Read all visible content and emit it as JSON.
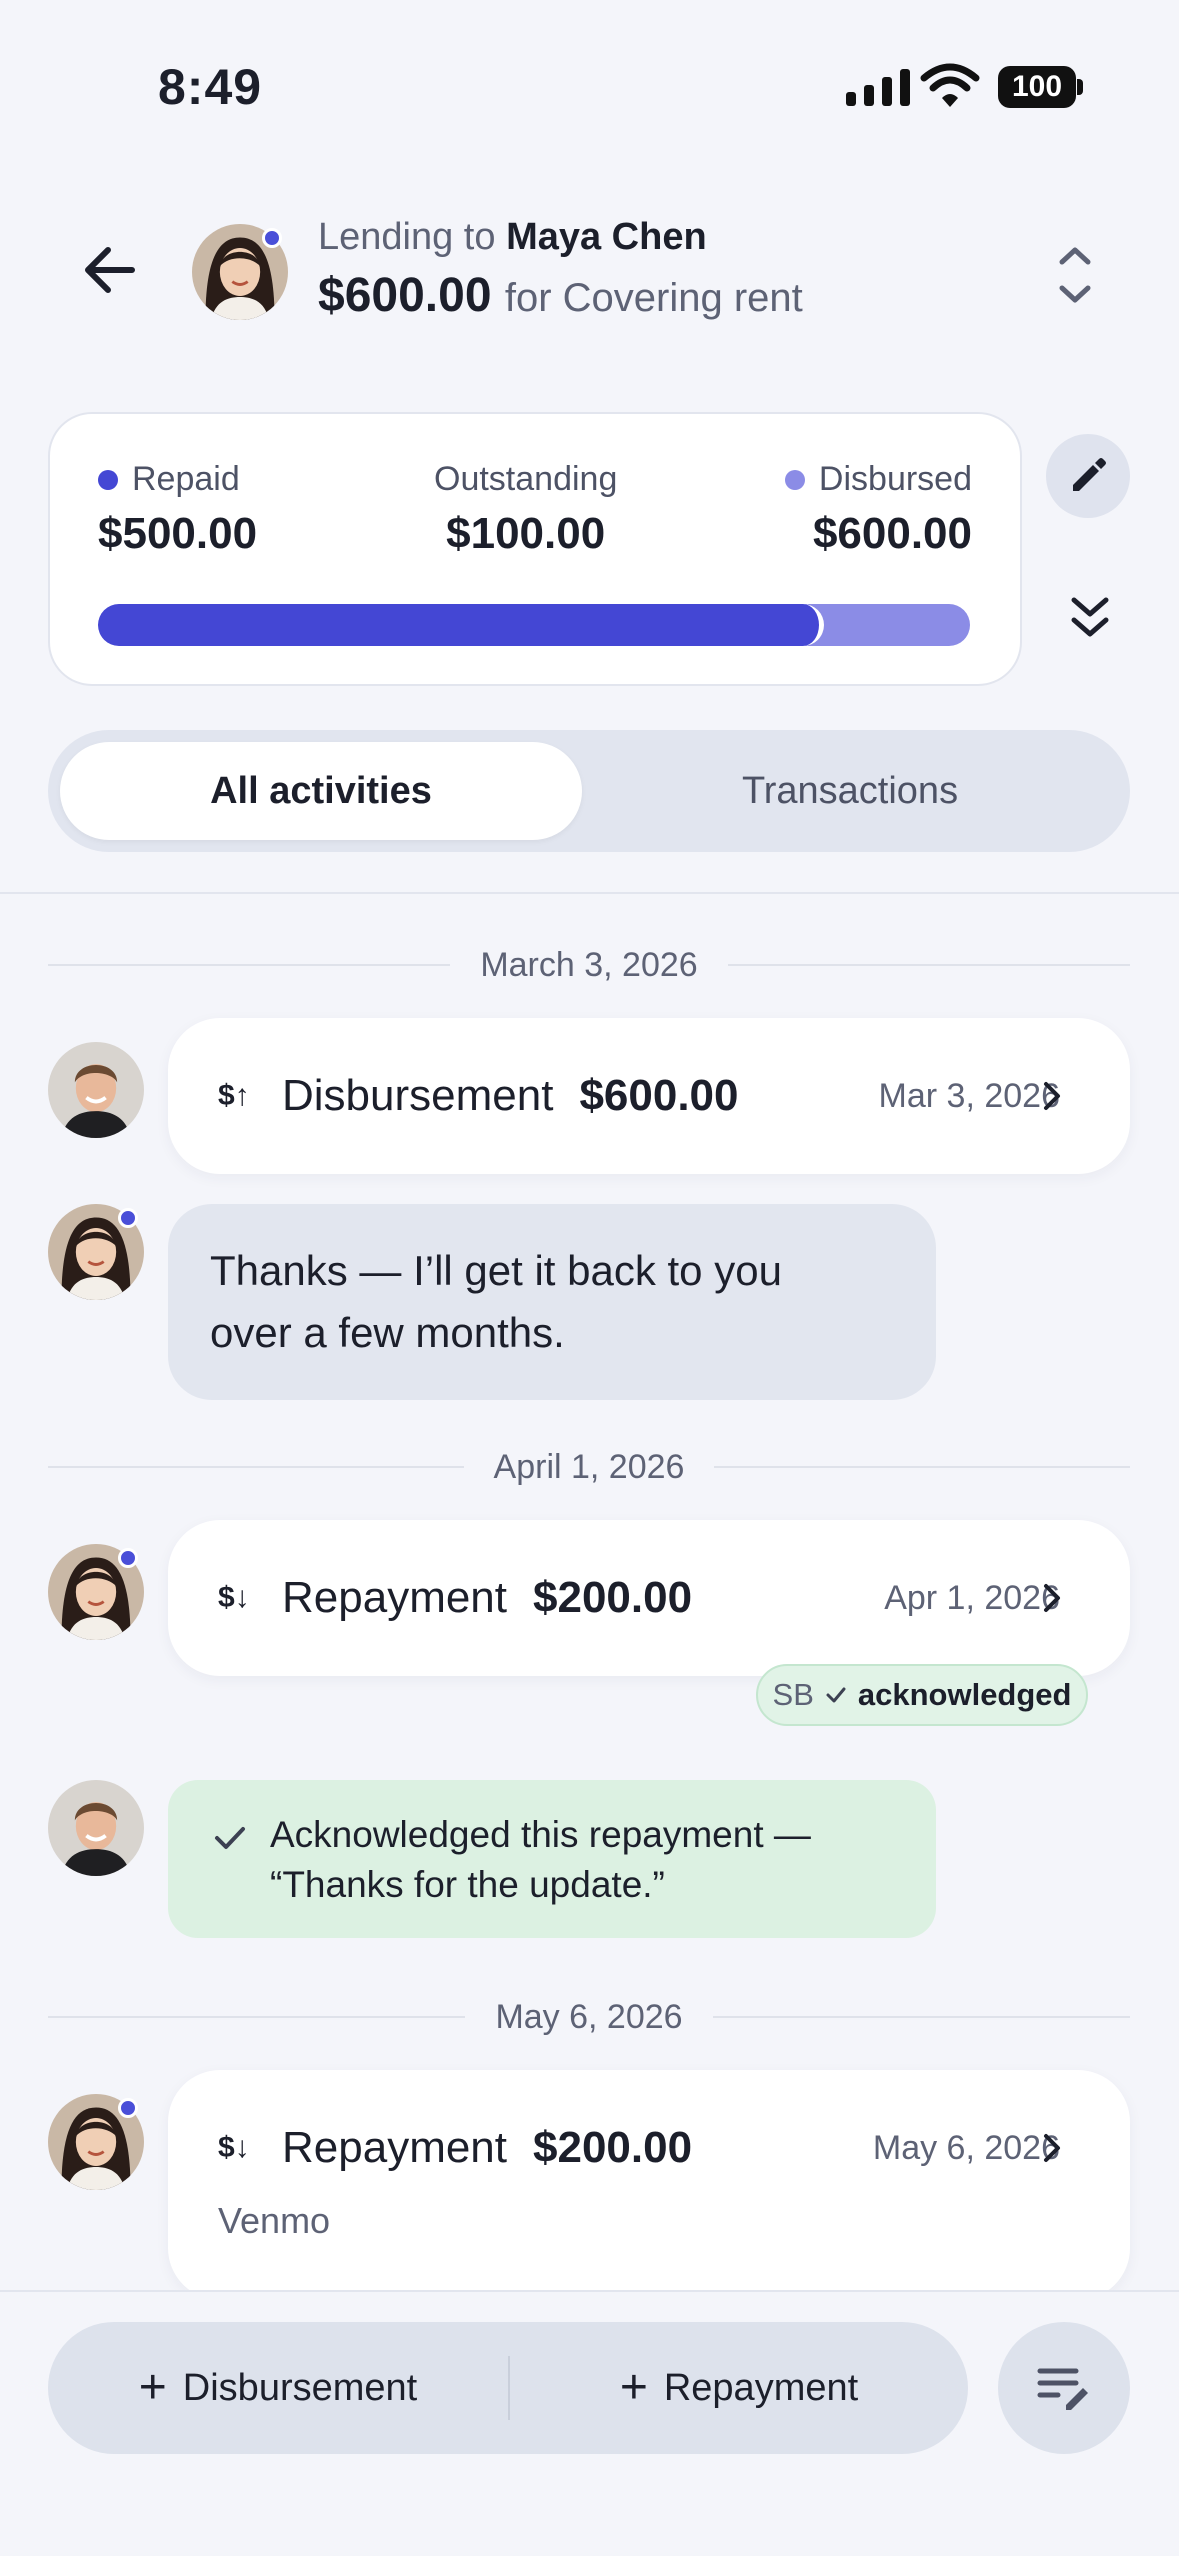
{
  "status_bar": {
    "time": "8:49",
    "battery": "100",
    "icons": [
      "signal-icon",
      "wifi-icon",
      "battery-icon"
    ]
  },
  "header": {
    "prefix": "Lending to",
    "name": "Maya Chen",
    "amount": "$600.00",
    "purpose": "for Covering rent",
    "icons": [
      "back-arrow-icon",
      "expand-collapse-icon"
    ]
  },
  "summary": {
    "repaid_label": "Repaid",
    "repaid_value": "$500.00",
    "outstanding_label": "Outstanding",
    "outstanding_value": "$100.00",
    "disbursed_label": "Disbursed",
    "disbursed_value": "$600.00",
    "progress_fraction": 0.833,
    "colors": {
      "repaid": "#4447d4",
      "disbursed": "#8b8ce6"
    },
    "icons": [
      "pencil-icon",
      "double-chevron-down-icon"
    ]
  },
  "tabs": [
    {
      "label": "All activities",
      "selected": true
    },
    {
      "label": "Transactions",
      "selected": false
    }
  ],
  "feed": {
    "date1": "March 3, 2026",
    "card1": {
      "icon": "$↑",
      "type": "Disbursement",
      "amount": "$600.00",
      "date": "Mar 3, 2026"
    },
    "message1_line1": "Thanks — I’ll get it back to you",
    "message1_line2": "over a few months.",
    "date2": "April 1, 2026",
    "card2": {
      "icon": "$↓",
      "type": "Repayment",
      "amount": "$200.00",
      "date": "Apr 1, 2026"
    },
    "ack_chip": {
      "initials": "SB",
      "label": "acknowledged"
    },
    "ack_message_line1": "Acknowledged this repayment —",
    "ack_message_line2": "“Thanks for the update.”",
    "date3": "May 6, 2026",
    "card3": {
      "icon": "$↓",
      "type": "Repayment",
      "amount": "$200.00",
      "date": "May 6, 2026",
      "note": "Venmo"
    }
  },
  "bottom": {
    "disbursement_label": "Disbursement",
    "repayment_label": "Repayment",
    "plus": "+",
    "icons": [
      "compose-note-icon"
    ]
  }
}
